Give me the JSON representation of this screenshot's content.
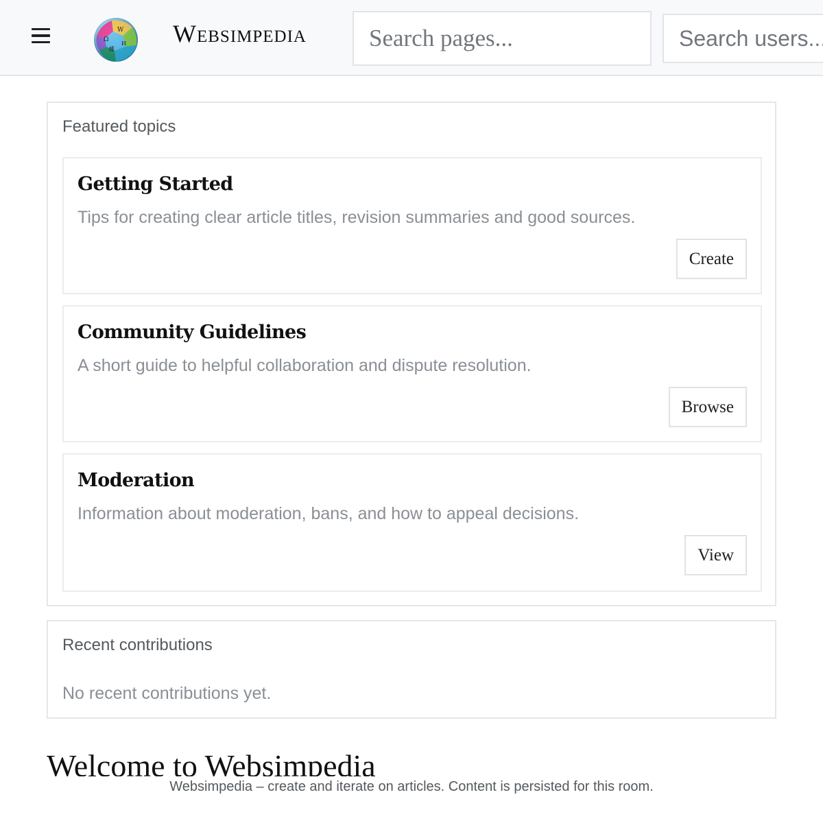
{
  "header": {
    "menu_icon": "hamburger-menu-icon",
    "logo_icon": "globe-puzzle-logo-icon",
    "site_name": "Websimpedia",
    "search_pages_placeholder": "Search pages...",
    "search_users_placeholder": "Search users..."
  },
  "featured": {
    "title": "Featured topics",
    "cards": [
      {
        "title": "Getting Started",
        "description": "Tips for creating clear article titles, revision summaries and good sources.",
        "button": "Create"
      },
      {
        "title": "Community Guidelines",
        "description": "A short guide to helpful collaboration and dispute resolution.",
        "button": "Browse"
      },
      {
        "title": "Moderation",
        "description": "Information about moderation, bans, and how to appeal decisions.",
        "button": "View"
      }
    ]
  },
  "recent": {
    "title": "Recent contributions",
    "empty_message": "No recent contributions yet."
  },
  "welcome": {
    "heading": "Welcome to Websimpedia"
  },
  "footer": {
    "text": "Websimpedia – create and iterate on articles. Content is persisted for this room."
  },
  "colors": {
    "header_bg": "#f8f9fa",
    "border": "#e4e6ea",
    "muted_text": "#8a8f95",
    "heading_text": "#111111"
  }
}
